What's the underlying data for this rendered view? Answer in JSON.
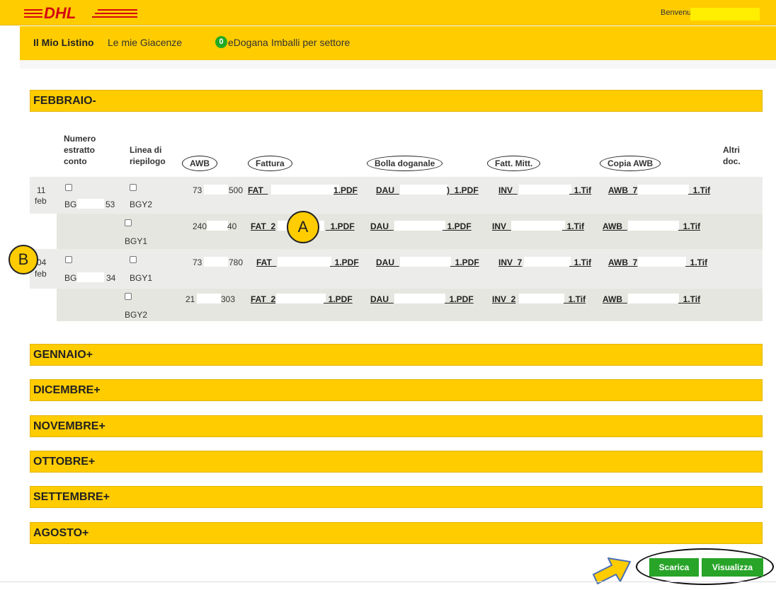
{
  "header": {
    "logo_text": "DHL",
    "welcome": "Benvenuto",
    "brand_color": "#ffcc00"
  },
  "nav": {
    "items": [
      {
        "label": "Il Mio Listino"
      },
      {
        "label": "Le mie Giacenze"
      },
      {
        "label": "eDogana"
      },
      {
        "label": "Imballi per settore"
      }
    ],
    "badge": "0"
  },
  "months": {
    "open": "FEBBRAIO-",
    "collapsed": [
      "GENNAIO+",
      "DICEMBRE+",
      "NOVEMBRE+",
      "OTTOBRE+",
      "SETTEMBRE+",
      "AGOSTO+"
    ]
  },
  "table": {
    "headers": {
      "numero": [
        "Numero",
        "estratto",
        "conto"
      ],
      "linea": [
        "Linea di",
        "riepilogo"
      ],
      "awb": "AWB",
      "fattura": "Fattura",
      "bolla": "Bolla doganale",
      "fatt_mitt": "Fatt. Mitt.",
      "copia_awb": "Copia AWB",
      "altri": [
        "Altri",
        "doc."
      ]
    },
    "rows": [
      {
        "day": "11",
        "month": "feb",
        "estratto": [
          "BG",
          "53"
        ],
        "linea": "BGY2",
        "awb": [
          "73",
          "500"
        ],
        "fattura": [
          "FAT_",
          "1.PDF"
        ],
        "bolla": [
          "DAU_",
          ")_1.PDF"
        ],
        "fatt_mitt": [
          "INV_",
          "_1.Tif"
        ],
        "copia": [
          "AWB_7",
          "_1.Tif"
        ]
      },
      {
        "linea": "BGY1",
        "awb": [
          "240",
          "40"
        ],
        "fattura": [
          "FAT_2",
          "_1.PDF"
        ],
        "bolla": [
          "DAU_",
          "_1.PDF"
        ],
        "fatt_mitt": [
          "INV_",
          "_1.Tif"
        ],
        "copia": [
          "AWB_",
          "_1.Tif"
        ]
      },
      {
        "day": "04",
        "month": "feb",
        "estratto": [
          "BG",
          "34"
        ],
        "linea": "BGY1",
        "awb": [
          "73",
          "780"
        ],
        "fattura": [
          "FAT_",
          "_1.PDF"
        ],
        "bolla": [
          "DAU_",
          "_1.PDF"
        ],
        "fatt_mitt": [
          "INV_7",
          "_1.Tif"
        ],
        "copia": [
          "AWB_7",
          "_1.Tif"
        ]
      },
      {
        "linea": "BGY2",
        "awb": [
          "21",
          "303"
        ],
        "fattura": [
          "FAT_2",
          "_1.PDF"
        ],
        "bolla": [
          "DAU_",
          "_1.PDF"
        ],
        "fatt_mitt": [
          "INV_2",
          "_1.Tif"
        ],
        "copia": [
          "AWB_",
          "_1.Tif"
        ]
      }
    ]
  },
  "markers": {
    "a": "A",
    "b": "B"
  },
  "buttons": {
    "scarica": "Scarica",
    "visualizza": "Visualizza",
    "button_color": "#28a428"
  }
}
